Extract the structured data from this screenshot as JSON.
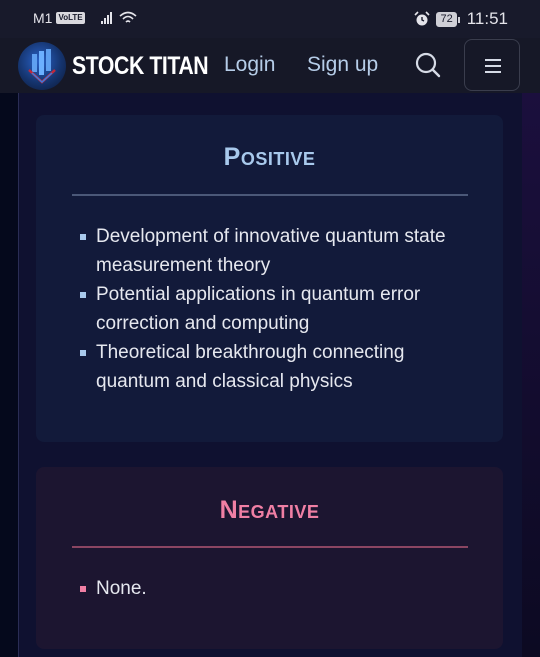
{
  "status_bar": {
    "carrier": "M1",
    "volte": "VoLTE",
    "battery": "72",
    "time": "11:51"
  },
  "navbar": {
    "brand": "STOCK TITAN",
    "login": "Login",
    "signup": "Sign up"
  },
  "positive": {
    "title": "Positive",
    "accent": "#a8c9ec",
    "items": [
      "Development of innovative quantum state measurement theory",
      "Potential applications in quantum error correction and computing",
      "Theoretical breakthrough connecting quantum and classical physics"
    ]
  },
  "negative": {
    "title": "Negative",
    "accent": "#f07fa4",
    "items": [
      "None."
    ]
  }
}
